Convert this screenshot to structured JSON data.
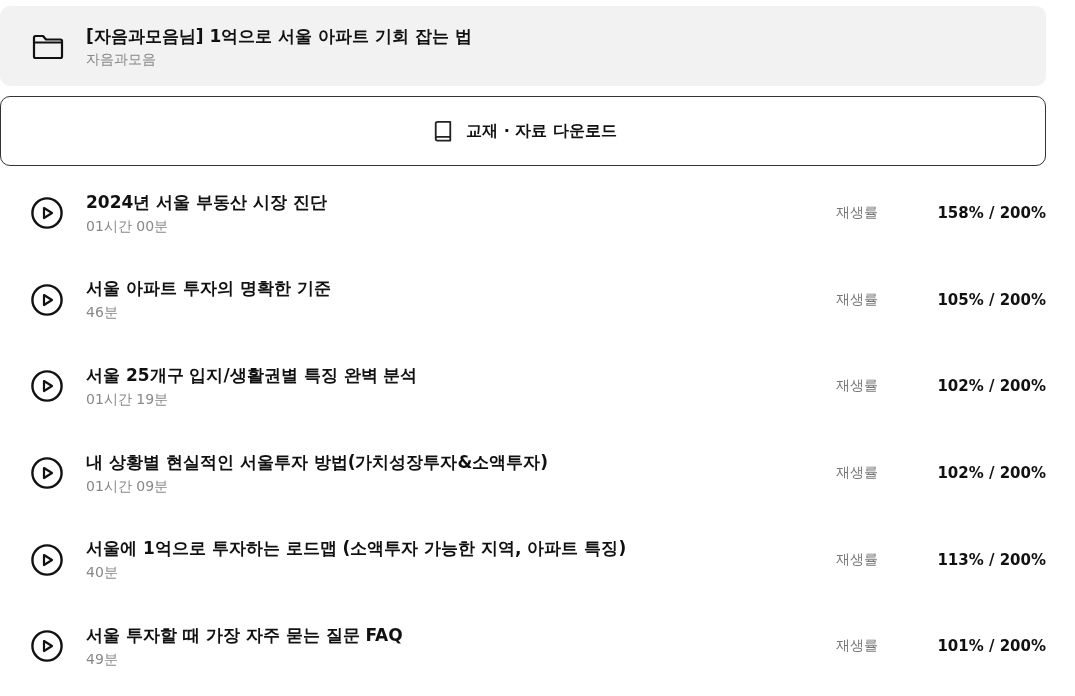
{
  "course": {
    "title": "[자음과모음님] 1억으로 서울 아파트 기회 잡는 법",
    "author": "자음과모음"
  },
  "download_button": {
    "label": "교재 · 자료 다운로드"
  },
  "lectures": [
    {
      "title": "2024년 서울 부동산 시장 진단",
      "duration": "01시간 00분",
      "rate_label": "재생률",
      "rate": "158% / 200%"
    },
    {
      "title": "서울 아파트 투자의 명확한 기준",
      "duration": "46분",
      "rate_label": "재생률",
      "rate": "105% / 200%"
    },
    {
      "title": "서울 25개구 입지/생활권별 특징 완벽 분석",
      "duration": "01시간 19분",
      "rate_label": "재생률",
      "rate": "102% / 200%"
    },
    {
      "title": "내 상황별 현실적인 서울투자 방법(가치성장투자&소액투자)",
      "duration": "01시간 09분",
      "rate_label": "재생률",
      "rate": "102% / 200%"
    },
    {
      "title": "서울에 1억으로 투자하는 로드맵 (소액투자 가능한 지역, 아파트 특징)",
      "duration": "40분",
      "rate_label": "재생률",
      "rate": "113% / 200%"
    },
    {
      "title": "서울 투자할 때 가장 자주 묻는 질문 FAQ",
      "duration": "49분",
      "rate_label": "재생률",
      "rate": "101% / 200%"
    }
  ]
}
